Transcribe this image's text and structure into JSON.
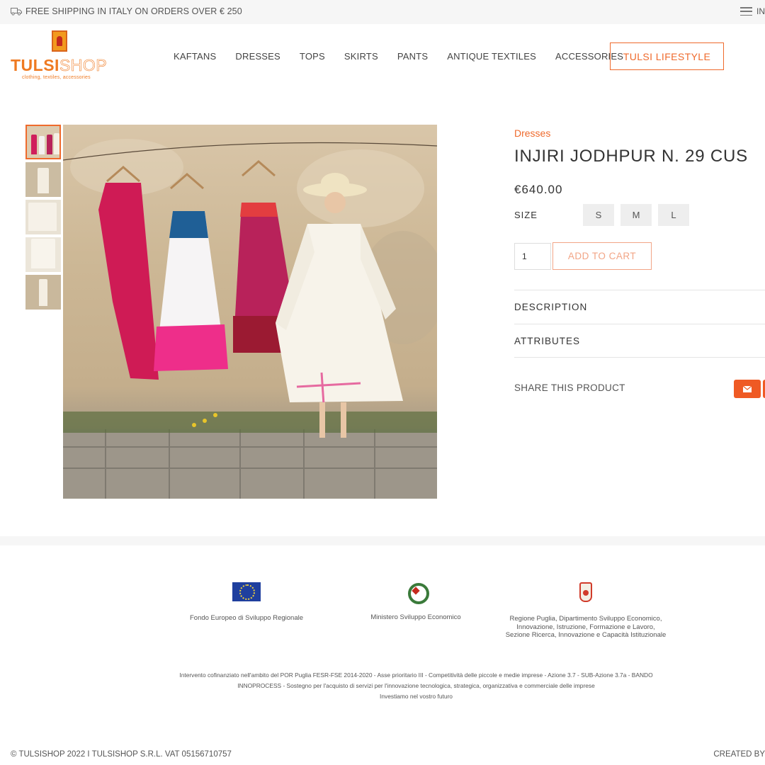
{
  "topbar": {
    "shipping_text": "FREE SHIPPING IN ITALY ON ORDERS OVER € 250",
    "menu_label": "IN"
  },
  "brand": {
    "name_part1": "TULSI",
    "name_part2": "SHOP",
    "tagline": "clothing, textiles, accessories",
    "accent_color": "#ef6a2c"
  },
  "nav": {
    "items": [
      "KAFTANS",
      "DRESSES",
      "TOPS",
      "SKIRTS",
      "PANTS",
      "ANTIQUE TEXTILES",
      "ACCESSORIES"
    ],
    "cta": "TULSI LIFESTYLE"
  },
  "product": {
    "category": "Dresses",
    "title": "INJIRI JODHPUR N. 29 CUS",
    "price": "€640.00",
    "size_label": "SIZE",
    "sizes": [
      "S",
      "M",
      "L"
    ],
    "quantity": "1",
    "add_to_cart": "ADD TO CART",
    "sections": [
      "DESCRIPTION",
      "ATTRIBUTES"
    ],
    "share_label": "SHARE THIS PRODUCT",
    "thumbnail_count": 5
  },
  "footer": {
    "funders": [
      {
        "icon": "eu-flag-icon",
        "text": "Fondo Europeo di Sviluppo Regionale"
      },
      {
        "icon": "italian-emblem-icon",
        "text": "Ministero Sviluppo Economico"
      },
      {
        "icon": "puglia-crest-icon",
        "text": "Regione Puglia, Dipartimento Sviluppo Economico, Innovazione, Istruzione, Formazione e Lavoro, Sezione Ricerca, Innovazione e Capacità Istituzionale"
      }
    ],
    "notice_line1": "Intervento cofinanziato nell'ambito del POR Puglia FESR-FSE 2014-2020 - Asse prioritario III - Competitività delle piccole e medie imprese - Azione 3.7 - SUB-Azione 3.7a - BANDO",
    "notice_line2": "INNOPROCESS - Sostegno per l'acquisto di servizi per l'innovazione tecnologica, strategica, organizzativa e commerciale delle imprese",
    "notice_line3": "Investiamo nel vostro futuro",
    "copyright": "© TULSISHOP 2022 I TULSISHOP S.R.L. VAT 05156710757",
    "created_by": "CREATED BY"
  }
}
